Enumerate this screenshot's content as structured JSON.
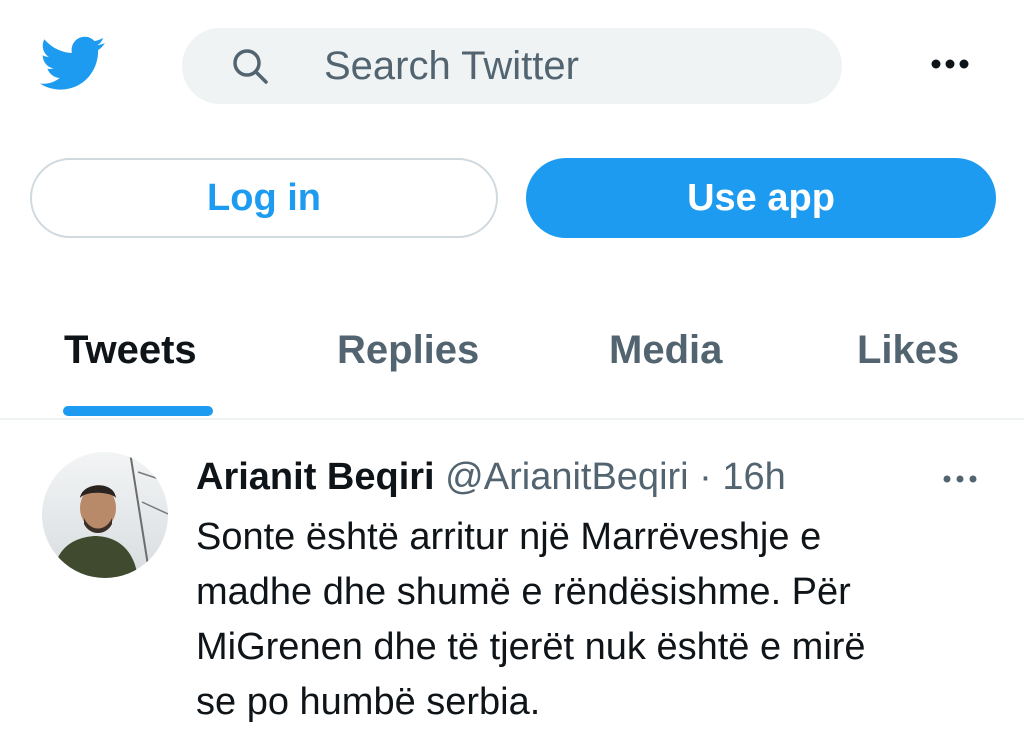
{
  "header": {
    "logo_icon": "twitter-bird-icon",
    "search_icon": "search-icon",
    "search_placeholder": "Search Twitter",
    "more_icon": "more-horizontal-icon"
  },
  "auth": {
    "login_label": "Log in",
    "use_app_label": "Use app"
  },
  "tabs": [
    {
      "label": "Tweets",
      "active": true
    },
    {
      "label": "Replies",
      "active": false
    },
    {
      "label": "Media",
      "active": false
    },
    {
      "label": "Likes",
      "active": false
    }
  ],
  "tweet": {
    "author_name": "Arianit Beqiri",
    "author_handle": "@ArianitBeqiri",
    "separator": "·",
    "time": "16h",
    "text_lines": [
      "Sonte është arritur një Marrëveshje e",
      "madhe dhe shumë e rëndësishme. Për",
      "MiGrenen dhe të tjerët nuk është e mirë",
      "se po humbë serbia."
    ],
    "more_icon": "more-horizontal-icon"
  },
  "colors": {
    "accent": "#1d9bf0",
    "secondary_text": "#536471",
    "primary_text": "#0f1419",
    "search_bg": "#eff3f4"
  }
}
